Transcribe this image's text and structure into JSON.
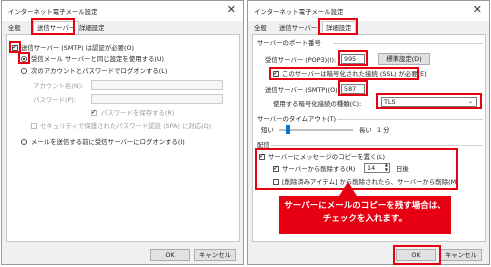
{
  "left_dialog": {
    "title": "インターネット電子メール設定",
    "close_label": "✕",
    "tabs": [
      "全般",
      "送信サーバー",
      "詳細設定"
    ],
    "auth_checkbox_label": "送信サーバー (SMTP) は認証が必要(O)",
    "radio_same_label": "受信メール サーバーと同じ設定を使用する(U)",
    "radio_account_label": "次のアカウントとパスワードでログオンする(L)",
    "account_name_label": "アカウント名(N):",
    "password_label": "パスワード(P):",
    "save_password_label": "パスワードを保存する(R)",
    "spa_label": "セキュリティで保護されたパスワード認証 (SPA) に対応(Q)",
    "radio_logon_first_label": "メールを送信する前に受信サーバーにログオンする(I)",
    "ok_label": "OK",
    "cancel_label": "キャンセル"
  },
  "right_dialog": {
    "title": "インターネット電子メール設定",
    "close_label": "✕",
    "tabs": [
      "全般",
      "送信サーバー",
      "詳細設定"
    ],
    "port_group_label": "サーバーのポート番号",
    "pop3_label": "受信サーバー (POP3)(I):",
    "pop3_value": "995",
    "default_button_label": "標準設定(D)",
    "ssl_label": "このサーバーは暗号化された接続 (SSL) が必要(E)",
    "smtp_label": "送信サーバー (SMTP)(O):",
    "smtp_value": "587",
    "encryption_label": "使用する暗号化接続の種類(C):",
    "encryption_value": "TLS",
    "timeout_group_label": "サーバーのタイムアウト(T)",
    "timeout_short": "短い",
    "timeout_long": "長い",
    "timeout_value": "1 分",
    "timeout_level": 0.12,
    "delivery_group_label": "配信",
    "leave_copy_label": "サーバーにメッセージのコピーを置く(L)",
    "remove_after_label": "サーバーから削除する(R)",
    "remove_days_value": "14",
    "days_label": "日後",
    "remove_deleted_label": "[削除済みアイテム] から削除されたら、サーバーから削除(M)",
    "ok_label": "OK",
    "cancel_label": "キャンセル"
  },
  "callout": {
    "line1": "サーバーにメールのコピーを残す場合は、",
    "line2": "チェックを入れます。"
  },
  "colors": {
    "highlight": "#e60012",
    "callout_bg": "#e60012"
  }
}
